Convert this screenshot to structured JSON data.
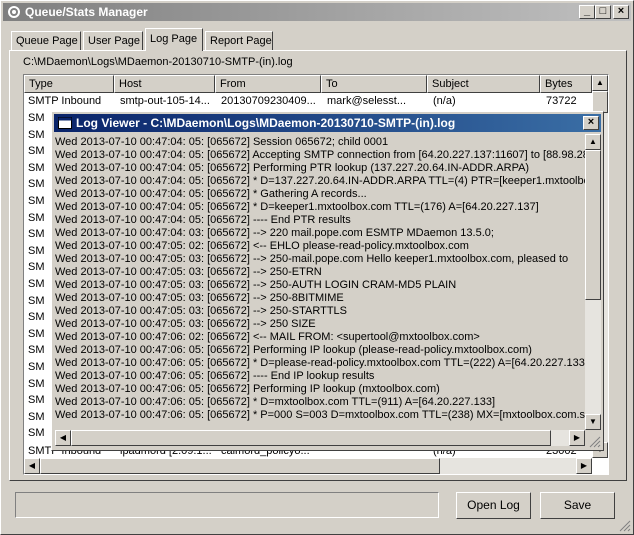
{
  "window": {
    "title": "Queue/Stats Manager"
  },
  "tabs": [
    {
      "label": "Queue Page"
    },
    {
      "label": "User Page"
    },
    {
      "label": "Log Page"
    },
    {
      "label": "Report Page"
    }
  ],
  "active_tab": "Log Page",
  "log_path": "C:\\MDaemon\\Logs\\MDaemon-20130710-SMTP-(in).log",
  "table": {
    "columns": [
      "Type",
      "Host",
      "From",
      "To",
      "Subject",
      "Bytes"
    ],
    "first_row": [
      "SMTP Inbound",
      "smtp-out-105-14...",
      "20130709230409...",
      "mark@selesst...",
      "(n/a)",
      "73722"
    ],
    "partial_row_prefix": "SM",
    "last_row": [
      "SMTP Inbound",
      "ipadmord [2.09.1...",
      "caimord_policyo...",
      "",
      "(n/a)",
      "23002"
    ]
  },
  "log_viewer": {
    "title": "Log Viewer - C:\\MDaemon\\Logs\\MDaemon-20130710-SMTP-(in).log",
    "lines": [
      "Wed 2013-07-10 00:47:04: 05: [065672] Session 065672; child 0001",
      "Wed 2013-07-10 00:47:04: 05: [065672] Accepting SMTP connection from [64.20.227.137:11607] to [88.98.28.",
      "Wed 2013-07-10 00:47:04: 05: [065672] Performing PTR lookup (137.227.20.64.IN-ADDR.ARPA)",
      "Wed 2013-07-10 00:47:04: 05: [065672] *  D=137.227.20.64.IN-ADDR.ARPA TTL=(4) PTR=[keeper1.mxtoolbox.cor",
      "Wed 2013-07-10 00:47:04: 05: [065672] *  Gathering A records...",
      "Wed 2013-07-10 00:47:04: 05: [065672] *  D=keeper1.mxtoolbox.com TTL=(176) A=[64.20.227.137]",
      "Wed 2013-07-10 00:47:04: 05: [065672] ---- End PTR results",
      "Wed 2013-07-10 00:47:04: 03: [065672] --> 220 mail.pope.com ESMTP MDaemon 13.5.0;",
      "Wed 2013-07-10 00:47:05: 02: [065672] <-- EHLO please-read-policy.mxtoolbox.com",
      "Wed 2013-07-10 00:47:05: 03: [065672] --> 250-mail.pope.com Hello keeper1.mxtoolbox.com, pleased to",
      "Wed 2013-07-10 00:47:05: 03: [065672] --> 250-ETRN",
      "Wed 2013-07-10 00:47:05: 03: [065672] --> 250-AUTH LOGIN CRAM-MD5 PLAIN",
      "Wed 2013-07-10 00:47:05: 03: [065672] --> 250-8BITMIME",
      "Wed 2013-07-10 00:47:05: 03: [065672] --> 250-STARTTLS",
      "Wed 2013-07-10 00:47:05: 03: [065672] --> 250 SIZE",
      "Wed 2013-07-10 00:47:06: 02: [065672] <-- MAIL FROM: <supertool@mxtoolbox.com>",
      "Wed 2013-07-10 00:47:06: 05: [065672] Performing IP lookup (please-read-policy.mxtoolbox.com)",
      "Wed 2013-07-10 00:47:06: 05: [065672] *  D=please-read-policy.mxtoolbox.com TTL=(222) A=[64.20.227.133]",
      "Wed 2013-07-10 00:47:06: 05: [065672] ---- End IP lookup results",
      "Wed 2013-07-10 00:47:06: 05: [065672] Performing IP lookup (mxtoolbox.com)",
      "Wed 2013-07-10 00:47:06: 05: [065672] *  D=mxtoolbox.com TTL=(911) A=[64.20.227.133]",
      "Wed 2013-07-10 00:47:06: 05: [065672] *  P=000 S=003 D=mxtoolbox.com TTL=(238) MX=[mxtoolbox.com.s5a"
    ]
  },
  "buttons": {
    "open_log": "Open Log",
    "save": "Save"
  },
  "icons": [
    "app-icon",
    "minimize-icon",
    "maximize-icon",
    "close-icon"
  ]
}
